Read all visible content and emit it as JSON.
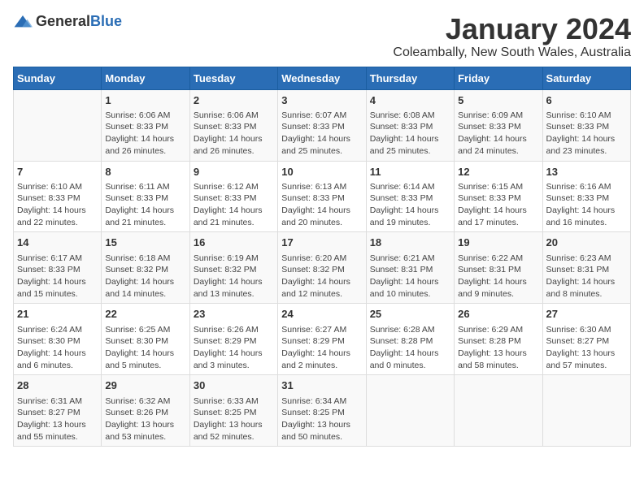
{
  "logo": {
    "general": "General",
    "blue": "Blue"
  },
  "title": "January 2024",
  "subtitle": "Coleambally, New South Wales, Australia",
  "days_of_week": [
    "Sunday",
    "Monday",
    "Tuesday",
    "Wednesday",
    "Thursday",
    "Friday",
    "Saturday"
  ],
  "weeks": [
    [
      {
        "day": "",
        "sunrise": "",
        "sunset": "",
        "daylight": ""
      },
      {
        "day": "1",
        "sunrise": "Sunrise: 6:06 AM",
        "sunset": "Sunset: 8:33 PM",
        "daylight": "Daylight: 14 hours and 26 minutes."
      },
      {
        "day": "2",
        "sunrise": "Sunrise: 6:06 AM",
        "sunset": "Sunset: 8:33 PM",
        "daylight": "Daylight: 14 hours and 26 minutes."
      },
      {
        "day": "3",
        "sunrise": "Sunrise: 6:07 AM",
        "sunset": "Sunset: 8:33 PM",
        "daylight": "Daylight: 14 hours and 25 minutes."
      },
      {
        "day": "4",
        "sunrise": "Sunrise: 6:08 AM",
        "sunset": "Sunset: 8:33 PM",
        "daylight": "Daylight: 14 hours and 25 minutes."
      },
      {
        "day": "5",
        "sunrise": "Sunrise: 6:09 AM",
        "sunset": "Sunset: 8:33 PM",
        "daylight": "Daylight: 14 hours and 24 minutes."
      },
      {
        "day": "6",
        "sunrise": "Sunrise: 6:10 AM",
        "sunset": "Sunset: 8:33 PM",
        "daylight": "Daylight: 14 hours and 23 minutes."
      }
    ],
    [
      {
        "day": "7",
        "sunrise": "Sunrise: 6:10 AM",
        "sunset": "Sunset: 8:33 PM",
        "daylight": "Daylight: 14 hours and 22 minutes."
      },
      {
        "day": "8",
        "sunrise": "Sunrise: 6:11 AM",
        "sunset": "Sunset: 8:33 PM",
        "daylight": "Daylight: 14 hours and 21 minutes."
      },
      {
        "day": "9",
        "sunrise": "Sunrise: 6:12 AM",
        "sunset": "Sunset: 8:33 PM",
        "daylight": "Daylight: 14 hours and 21 minutes."
      },
      {
        "day": "10",
        "sunrise": "Sunrise: 6:13 AM",
        "sunset": "Sunset: 8:33 PM",
        "daylight": "Daylight: 14 hours and 20 minutes."
      },
      {
        "day": "11",
        "sunrise": "Sunrise: 6:14 AM",
        "sunset": "Sunset: 8:33 PM",
        "daylight": "Daylight: 14 hours and 19 minutes."
      },
      {
        "day": "12",
        "sunrise": "Sunrise: 6:15 AM",
        "sunset": "Sunset: 8:33 PM",
        "daylight": "Daylight: 14 hours and 17 minutes."
      },
      {
        "day": "13",
        "sunrise": "Sunrise: 6:16 AM",
        "sunset": "Sunset: 8:33 PM",
        "daylight": "Daylight: 14 hours and 16 minutes."
      }
    ],
    [
      {
        "day": "14",
        "sunrise": "Sunrise: 6:17 AM",
        "sunset": "Sunset: 8:33 PM",
        "daylight": "Daylight: 14 hours and 15 minutes."
      },
      {
        "day": "15",
        "sunrise": "Sunrise: 6:18 AM",
        "sunset": "Sunset: 8:32 PM",
        "daylight": "Daylight: 14 hours and 14 minutes."
      },
      {
        "day": "16",
        "sunrise": "Sunrise: 6:19 AM",
        "sunset": "Sunset: 8:32 PM",
        "daylight": "Daylight: 14 hours and 13 minutes."
      },
      {
        "day": "17",
        "sunrise": "Sunrise: 6:20 AM",
        "sunset": "Sunset: 8:32 PM",
        "daylight": "Daylight: 14 hours and 12 minutes."
      },
      {
        "day": "18",
        "sunrise": "Sunrise: 6:21 AM",
        "sunset": "Sunset: 8:31 PM",
        "daylight": "Daylight: 14 hours and 10 minutes."
      },
      {
        "day": "19",
        "sunrise": "Sunrise: 6:22 AM",
        "sunset": "Sunset: 8:31 PM",
        "daylight": "Daylight: 14 hours and 9 minutes."
      },
      {
        "day": "20",
        "sunrise": "Sunrise: 6:23 AM",
        "sunset": "Sunset: 8:31 PM",
        "daylight": "Daylight: 14 hours and 8 minutes."
      }
    ],
    [
      {
        "day": "21",
        "sunrise": "Sunrise: 6:24 AM",
        "sunset": "Sunset: 8:30 PM",
        "daylight": "Daylight: 14 hours and 6 minutes."
      },
      {
        "day": "22",
        "sunrise": "Sunrise: 6:25 AM",
        "sunset": "Sunset: 8:30 PM",
        "daylight": "Daylight: 14 hours and 5 minutes."
      },
      {
        "day": "23",
        "sunrise": "Sunrise: 6:26 AM",
        "sunset": "Sunset: 8:29 PM",
        "daylight": "Daylight: 14 hours and 3 minutes."
      },
      {
        "day": "24",
        "sunrise": "Sunrise: 6:27 AM",
        "sunset": "Sunset: 8:29 PM",
        "daylight": "Daylight: 14 hours and 2 minutes."
      },
      {
        "day": "25",
        "sunrise": "Sunrise: 6:28 AM",
        "sunset": "Sunset: 8:28 PM",
        "daylight": "Daylight: 14 hours and 0 minutes."
      },
      {
        "day": "26",
        "sunrise": "Sunrise: 6:29 AM",
        "sunset": "Sunset: 8:28 PM",
        "daylight": "Daylight: 13 hours and 58 minutes."
      },
      {
        "day": "27",
        "sunrise": "Sunrise: 6:30 AM",
        "sunset": "Sunset: 8:27 PM",
        "daylight": "Daylight: 13 hours and 57 minutes."
      }
    ],
    [
      {
        "day": "28",
        "sunrise": "Sunrise: 6:31 AM",
        "sunset": "Sunset: 8:27 PM",
        "daylight": "Daylight: 13 hours and 55 minutes."
      },
      {
        "day": "29",
        "sunrise": "Sunrise: 6:32 AM",
        "sunset": "Sunset: 8:26 PM",
        "daylight": "Daylight: 13 hours and 53 minutes."
      },
      {
        "day": "30",
        "sunrise": "Sunrise: 6:33 AM",
        "sunset": "Sunset: 8:25 PM",
        "daylight": "Daylight: 13 hours and 52 minutes."
      },
      {
        "day": "31",
        "sunrise": "Sunrise: 6:34 AM",
        "sunset": "Sunset: 8:25 PM",
        "daylight": "Daylight: 13 hours and 50 minutes."
      },
      {
        "day": "",
        "sunrise": "",
        "sunset": "",
        "daylight": ""
      },
      {
        "day": "",
        "sunrise": "",
        "sunset": "",
        "daylight": ""
      },
      {
        "day": "",
        "sunrise": "",
        "sunset": "",
        "daylight": ""
      }
    ]
  ]
}
